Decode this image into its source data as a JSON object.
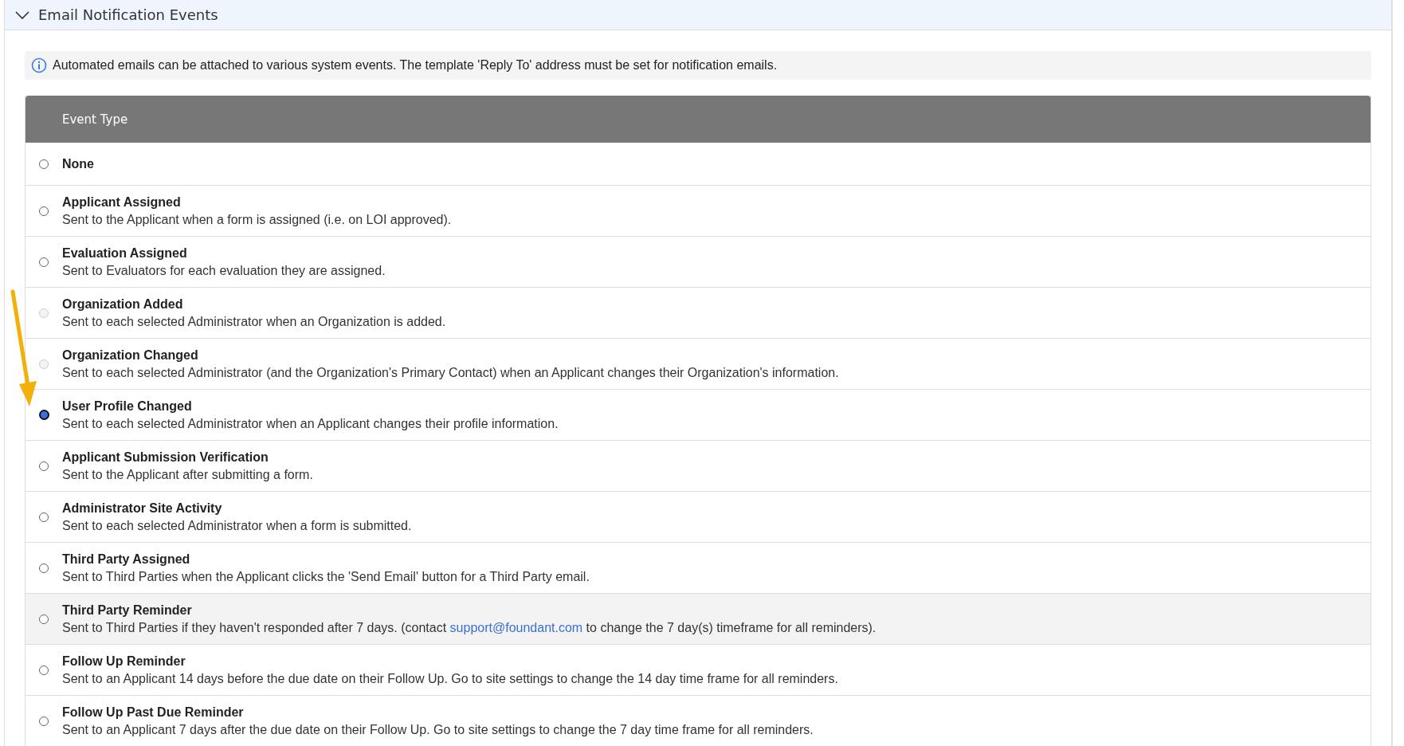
{
  "section": {
    "title": "Email Notification Events",
    "expanded": true
  },
  "info": "Automated emails can be attached to various system events. The template 'Reply To' address must be set for notification emails.",
  "table": {
    "columns": [
      "Event Type"
    ],
    "rows": [
      {
        "name": "None",
        "selected": false,
        "disabled": false,
        "highlighted": false
      },
      {
        "name": "Applicant Assigned",
        "description": "Sent to the Applicant when a form is assigned (i.e. on LOI approved).",
        "selected": false,
        "disabled": false,
        "highlighted": false
      },
      {
        "name": "Evaluation Assigned",
        "description": "Sent to Evaluators for each evaluation they are assigned.",
        "selected": false,
        "disabled": false,
        "highlighted": false
      },
      {
        "name": "Organization Added",
        "description": "Sent to each selected Administrator when an Organization is added.",
        "selected": false,
        "disabled": true,
        "highlighted": false
      },
      {
        "name": "Organization Changed",
        "description": "Sent to each selected Administrator (and the Organization's Primary Contact) when an Applicant changes their Organization's information.",
        "selected": false,
        "disabled": true,
        "highlighted": false
      },
      {
        "name": "User Profile Changed",
        "description": "Sent to each selected Administrator when an Applicant changes their profile information.",
        "selected": true,
        "disabled": false,
        "highlighted": false
      },
      {
        "name": "Applicant Submission Verification",
        "description": "Sent to the Applicant after submitting a form.",
        "selected": false,
        "disabled": false,
        "highlighted": false
      },
      {
        "name": "Administrator Site Activity",
        "description": "Sent to each selected Administrator when a form is submitted.",
        "selected": false,
        "disabled": false,
        "highlighted": false
      },
      {
        "name": "Third Party Assigned",
        "description": "Sent to Third Parties when the Applicant clicks the 'Send Email' button for a Third Party email.",
        "selected": false,
        "disabled": false,
        "highlighted": false
      },
      {
        "name": "Third Party Reminder",
        "description": "Sent to Third Parties if they haven't responded after 7 days. (contact ",
        "link": "support@foundant.com",
        "description_end": " to change the 7 day(s) timeframe for all reminders).",
        "selected": false,
        "disabled": false,
        "highlighted": true
      },
      {
        "name": "Follow Up Reminder",
        "description": "Sent to an Applicant 14 days before the due date on their Follow Up. Go to site settings to change the 14 day time frame for all reminders.",
        "selected": false,
        "disabled": false,
        "highlighted": false
      },
      {
        "name": "Follow Up Past Due Reminder",
        "description": "Sent to an Applicant 7 days after the due date on their Follow Up. Go to site settings to change the 7 day time frame for all reminders.",
        "selected": false,
        "disabled": false,
        "highlighted": false
      }
    ]
  }
}
